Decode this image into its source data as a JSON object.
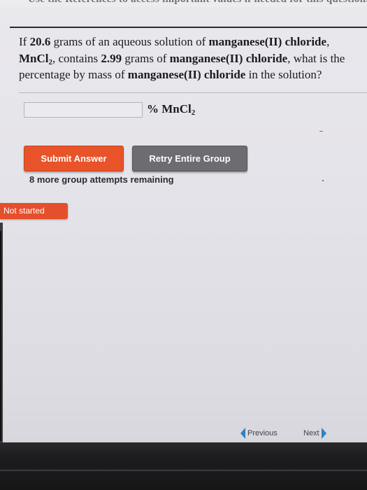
{
  "header": {
    "banner_text": "Use the References to access important values if needed for this question."
  },
  "question": {
    "p1": "If ",
    "solution_mass": "20.6",
    "p2": " grams of an aqueous solution of ",
    "compound_name": "manganese(II) chloride",
    "p3": ",",
    "formula_base": "MnCl",
    "formula_sub": "2",
    "p4": ", contains ",
    "solute_mass": "2.99",
    "p5": " grams of ",
    "compound_name_2": "manganese(II) chloride",
    "p6": ", what is the percentage by mass of ",
    "compound_name_3": "manganese(II) chloride",
    "p7": " in the solution?"
  },
  "answer": {
    "value": "",
    "placeholder": "",
    "unit_prefix": "% MnCl",
    "unit_sub": "2"
  },
  "buttons": {
    "submit_label": "Submit Answer",
    "retry_label": "Retry Entire Group"
  },
  "attempts_text": "8 more group attempts remaining",
  "status_label": "Not started",
  "nav": {
    "previous_label": "Previous",
    "next_label": "Next"
  },
  "colors": {
    "submit_bg": "#e8532a",
    "retry_bg": "#6d6d71",
    "status_bg": "#e44f2c",
    "nav_chevron": "#2a84c4"
  }
}
